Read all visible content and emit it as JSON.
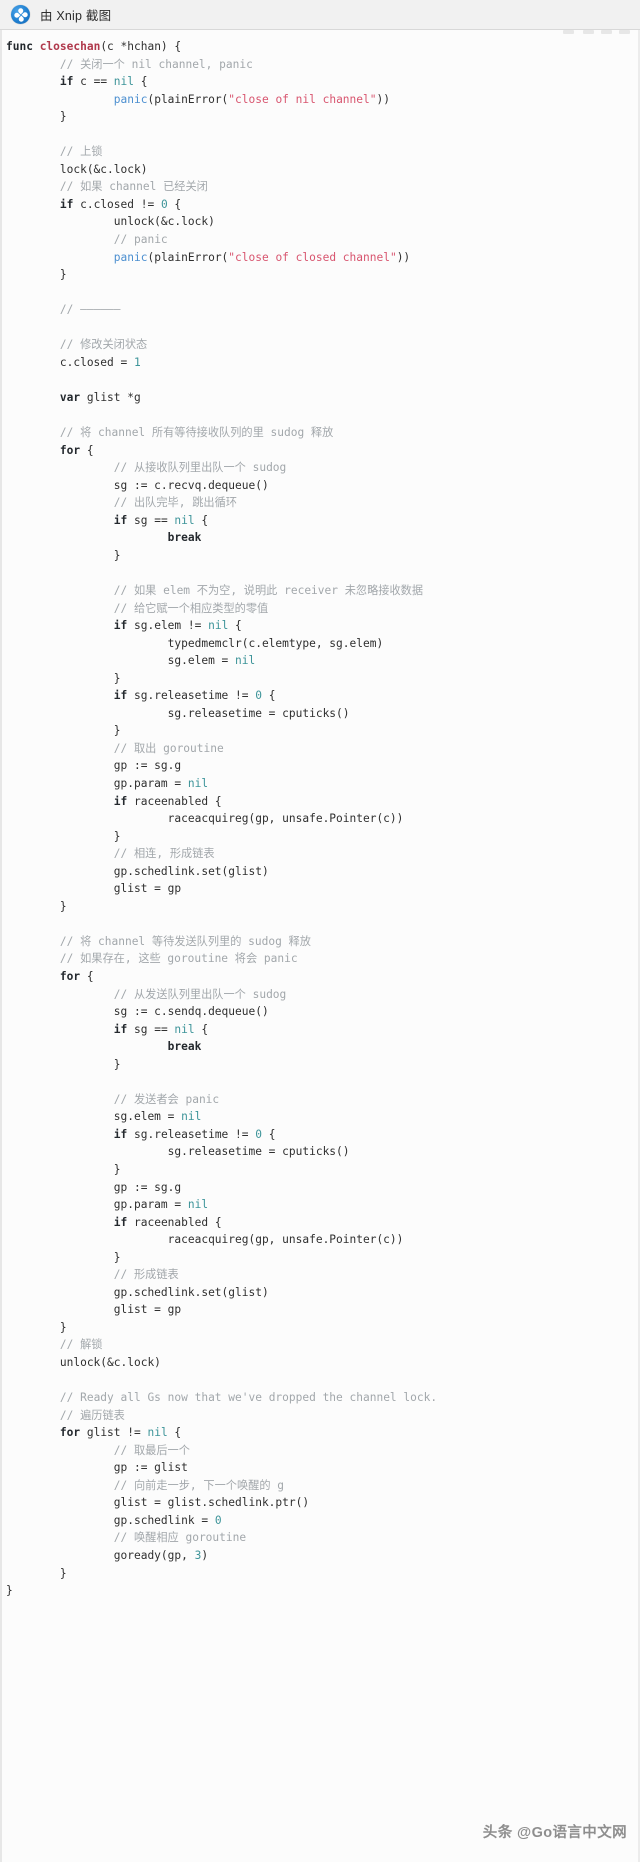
{
  "titlebar": {
    "logo_icon": "xnip-logo-icon",
    "label": "由 Xnip 截图"
  },
  "watermark": {
    "text": "头条 @Go语言中文网"
  },
  "colors": {
    "titlebar_bg": "#f1f1f1",
    "code_bg": "#fcfcfc",
    "keyword": "#24292e",
    "function_name": "#b0394c",
    "literal": "#3d9499",
    "number": "#3d9499",
    "panic": "#4c8fd0",
    "string": "#d8556f",
    "comment": "#a2a7ab",
    "plain": "#2f2f2f",
    "watermark": "#8e8e8e"
  },
  "code": {
    "language": "go",
    "function": "closechan",
    "lines": [
      [
        {
          "t": "func ",
          "c": "kw"
        },
        {
          "t": "closechan",
          "c": "fn"
        },
        {
          "t": "(c *hchan) {",
          "c": "pl"
        }
      ],
      [
        {
          "t": "        ",
          "c": "pl"
        },
        {
          "t": "// 关闭一个 nil channel, panic",
          "c": "cm"
        }
      ],
      [
        {
          "t": "        ",
          "c": "pl"
        },
        {
          "t": "if",
          "c": "kw"
        },
        {
          "t": " c == ",
          "c": "pl"
        },
        {
          "t": "nil",
          "c": "lit"
        },
        {
          "t": " {",
          "c": "pl"
        }
      ],
      [
        {
          "t": "                ",
          "c": "pl"
        },
        {
          "t": "panic",
          "c": "pan"
        },
        {
          "t": "(plainError(",
          "c": "pl"
        },
        {
          "t": "\"close of nil channel\"",
          "c": "str"
        },
        {
          "t": "))",
          "c": "pl"
        }
      ],
      [
        {
          "t": "        }",
          "c": "pl"
        }
      ],
      [
        {
          "t": "",
          "c": "pl"
        }
      ],
      [
        {
          "t": "        ",
          "c": "pl"
        },
        {
          "t": "// 上锁",
          "c": "cm"
        }
      ],
      [
        {
          "t": "        lock(&c.lock)",
          "c": "pl"
        }
      ],
      [
        {
          "t": "        ",
          "c": "pl"
        },
        {
          "t": "// 如果 channel 已经关闭",
          "c": "cm"
        }
      ],
      [
        {
          "t": "        ",
          "c": "pl"
        },
        {
          "t": "if",
          "c": "kw"
        },
        {
          "t": " c.closed != ",
          "c": "pl"
        },
        {
          "t": "0",
          "c": "num"
        },
        {
          "t": " {",
          "c": "pl"
        }
      ],
      [
        {
          "t": "                unlock(&c.lock)",
          "c": "pl"
        }
      ],
      [
        {
          "t": "                ",
          "c": "pl"
        },
        {
          "t": "// panic",
          "c": "cm"
        }
      ],
      [
        {
          "t": "                ",
          "c": "pl"
        },
        {
          "t": "panic",
          "c": "pan"
        },
        {
          "t": "(plainError(",
          "c": "pl"
        },
        {
          "t": "\"close of closed channel\"",
          "c": "str"
        },
        {
          "t": "))",
          "c": "pl"
        }
      ],
      [
        {
          "t": "        }",
          "c": "pl"
        }
      ],
      [
        {
          "t": "",
          "c": "pl"
        }
      ],
      [
        {
          "t": "        ",
          "c": "pl"
        },
        {
          "t": "// ——————",
          "c": "cm"
        }
      ],
      [
        {
          "t": "",
          "c": "pl"
        }
      ],
      [
        {
          "t": "        ",
          "c": "pl"
        },
        {
          "t": "// 修改关闭状态",
          "c": "cm"
        }
      ],
      [
        {
          "t": "        c.closed = ",
          "c": "pl"
        },
        {
          "t": "1",
          "c": "num"
        }
      ],
      [
        {
          "t": "",
          "c": "pl"
        }
      ],
      [
        {
          "t": "        ",
          "c": "pl"
        },
        {
          "t": "var",
          "c": "kw"
        },
        {
          "t": " glist *g",
          "c": "pl"
        }
      ],
      [
        {
          "t": "",
          "c": "pl"
        }
      ],
      [
        {
          "t": "        ",
          "c": "pl"
        },
        {
          "t": "// 将 channel 所有等待接收队列的里 sudog 释放",
          "c": "cm"
        }
      ],
      [
        {
          "t": "        ",
          "c": "pl"
        },
        {
          "t": "for",
          "c": "kw"
        },
        {
          "t": " {",
          "c": "pl"
        }
      ],
      [
        {
          "t": "                ",
          "c": "pl"
        },
        {
          "t": "// 从接收队列里出队一个 sudog",
          "c": "cm"
        }
      ],
      [
        {
          "t": "                sg := c.recvq.dequeue()",
          "c": "pl"
        }
      ],
      [
        {
          "t": "                ",
          "c": "pl"
        },
        {
          "t": "// 出队完毕, 跳出循环",
          "c": "cm"
        }
      ],
      [
        {
          "t": "                ",
          "c": "pl"
        },
        {
          "t": "if",
          "c": "kw"
        },
        {
          "t": " sg == ",
          "c": "pl"
        },
        {
          "t": "nil",
          "c": "lit"
        },
        {
          "t": " {",
          "c": "pl"
        }
      ],
      [
        {
          "t": "                        ",
          "c": "pl"
        },
        {
          "t": "break",
          "c": "kw"
        }
      ],
      [
        {
          "t": "                }",
          "c": "pl"
        }
      ],
      [
        {
          "t": "",
          "c": "pl"
        }
      ],
      [
        {
          "t": "                ",
          "c": "pl"
        },
        {
          "t": "// 如果 elem 不为空, 说明此 receiver 未忽略接收数据",
          "c": "cm"
        }
      ],
      [
        {
          "t": "                ",
          "c": "pl"
        },
        {
          "t": "// 给它赋一个相应类型的零值",
          "c": "cm"
        }
      ],
      [
        {
          "t": "                ",
          "c": "pl"
        },
        {
          "t": "if",
          "c": "kw"
        },
        {
          "t": " sg.elem != ",
          "c": "pl"
        },
        {
          "t": "nil",
          "c": "lit"
        },
        {
          "t": " {",
          "c": "pl"
        }
      ],
      [
        {
          "t": "                        typedmemclr(c.elemtype, sg.elem)",
          "c": "pl"
        }
      ],
      [
        {
          "t": "                        sg.elem = ",
          "c": "pl"
        },
        {
          "t": "nil",
          "c": "lit"
        }
      ],
      [
        {
          "t": "                }",
          "c": "pl"
        }
      ],
      [
        {
          "t": "                ",
          "c": "pl"
        },
        {
          "t": "if",
          "c": "kw"
        },
        {
          "t": " sg.releasetime != ",
          "c": "pl"
        },
        {
          "t": "0",
          "c": "num"
        },
        {
          "t": " {",
          "c": "pl"
        }
      ],
      [
        {
          "t": "                        sg.releasetime = cputicks()",
          "c": "pl"
        }
      ],
      [
        {
          "t": "                }",
          "c": "pl"
        }
      ],
      [
        {
          "t": "                ",
          "c": "pl"
        },
        {
          "t": "// 取出 goroutine",
          "c": "cm"
        }
      ],
      [
        {
          "t": "                gp := sg.g",
          "c": "pl"
        }
      ],
      [
        {
          "t": "                gp.param = ",
          "c": "pl"
        },
        {
          "t": "nil",
          "c": "lit"
        }
      ],
      [
        {
          "t": "                ",
          "c": "pl"
        },
        {
          "t": "if",
          "c": "kw"
        },
        {
          "t": " raceenabled {",
          "c": "pl"
        }
      ],
      [
        {
          "t": "                        raceacquireg(gp, unsafe.Pointer(c))",
          "c": "pl"
        }
      ],
      [
        {
          "t": "                }",
          "c": "pl"
        }
      ],
      [
        {
          "t": "                ",
          "c": "pl"
        },
        {
          "t": "// 相连, 形成链表",
          "c": "cm"
        }
      ],
      [
        {
          "t": "                gp.schedlink.set(glist)",
          "c": "pl"
        }
      ],
      [
        {
          "t": "                glist = gp",
          "c": "pl"
        }
      ],
      [
        {
          "t": "        }",
          "c": "pl"
        }
      ],
      [
        {
          "t": "",
          "c": "pl"
        }
      ],
      [
        {
          "t": "        ",
          "c": "pl"
        },
        {
          "t": "// 将 channel 等待发送队列里的 sudog 释放",
          "c": "cm"
        }
      ],
      [
        {
          "t": "        ",
          "c": "pl"
        },
        {
          "t": "// 如果存在, 这些 goroutine 将会 panic",
          "c": "cm"
        }
      ],
      [
        {
          "t": "        ",
          "c": "pl"
        },
        {
          "t": "for",
          "c": "kw"
        },
        {
          "t": " {",
          "c": "pl"
        }
      ],
      [
        {
          "t": "                ",
          "c": "pl"
        },
        {
          "t": "// 从发送队列里出队一个 sudog",
          "c": "cm"
        }
      ],
      [
        {
          "t": "                sg := c.sendq.dequeue()",
          "c": "pl"
        }
      ],
      [
        {
          "t": "                ",
          "c": "pl"
        },
        {
          "t": "if",
          "c": "kw"
        },
        {
          "t": " sg == ",
          "c": "pl"
        },
        {
          "t": "nil",
          "c": "lit"
        },
        {
          "t": " {",
          "c": "pl"
        }
      ],
      [
        {
          "t": "                        ",
          "c": "pl"
        },
        {
          "t": "break",
          "c": "kw"
        }
      ],
      [
        {
          "t": "                }",
          "c": "pl"
        }
      ],
      [
        {
          "t": "",
          "c": "pl"
        }
      ],
      [
        {
          "t": "                ",
          "c": "pl"
        },
        {
          "t": "// 发送者会 panic",
          "c": "cm"
        }
      ],
      [
        {
          "t": "                sg.elem = ",
          "c": "pl"
        },
        {
          "t": "nil",
          "c": "lit"
        }
      ],
      [
        {
          "t": "                ",
          "c": "pl"
        },
        {
          "t": "if",
          "c": "kw"
        },
        {
          "t": " sg.releasetime != ",
          "c": "pl"
        },
        {
          "t": "0",
          "c": "num"
        },
        {
          "t": " {",
          "c": "pl"
        }
      ],
      [
        {
          "t": "                        sg.releasetime = cputicks()",
          "c": "pl"
        }
      ],
      [
        {
          "t": "                }",
          "c": "pl"
        }
      ],
      [
        {
          "t": "                gp := sg.g",
          "c": "pl"
        }
      ],
      [
        {
          "t": "                gp.param = ",
          "c": "pl"
        },
        {
          "t": "nil",
          "c": "lit"
        }
      ],
      [
        {
          "t": "                ",
          "c": "pl"
        },
        {
          "t": "if",
          "c": "kw"
        },
        {
          "t": " raceenabled {",
          "c": "pl"
        }
      ],
      [
        {
          "t": "                        raceacquireg(gp, unsafe.Pointer(c))",
          "c": "pl"
        }
      ],
      [
        {
          "t": "                }",
          "c": "pl"
        }
      ],
      [
        {
          "t": "                ",
          "c": "pl"
        },
        {
          "t": "// 形成链表",
          "c": "cm"
        }
      ],
      [
        {
          "t": "                gp.schedlink.set(glist)",
          "c": "pl"
        }
      ],
      [
        {
          "t": "                glist = gp",
          "c": "pl"
        }
      ],
      [
        {
          "t": "        }",
          "c": "pl"
        }
      ],
      [
        {
          "t": "        ",
          "c": "pl"
        },
        {
          "t": "// 解锁",
          "c": "cm"
        }
      ],
      [
        {
          "t": "        unlock(&c.lock)",
          "c": "pl"
        }
      ],
      [
        {
          "t": "",
          "c": "pl"
        }
      ],
      [
        {
          "t": "        ",
          "c": "pl"
        },
        {
          "t": "// Ready all Gs now that we've dropped the channel lock.",
          "c": "cm"
        }
      ],
      [
        {
          "t": "        ",
          "c": "pl"
        },
        {
          "t": "// 遍历链表",
          "c": "cm"
        }
      ],
      [
        {
          "t": "        ",
          "c": "pl"
        },
        {
          "t": "for",
          "c": "kw"
        },
        {
          "t": " glist != ",
          "c": "pl"
        },
        {
          "t": "nil",
          "c": "lit"
        },
        {
          "t": " {",
          "c": "pl"
        }
      ],
      [
        {
          "t": "                ",
          "c": "pl"
        },
        {
          "t": "// 取最后一个",
          "c": "cm"
        }
      ],
      [
        {
          "t": "                gp := glist",
          "c": "pl"
        }
      ],
      [
        {
          "t": "                ",
          "c": "pl"
        },
        {
          "t": "// 向前走一步, 下一个唤醒的 g",
          "c": "cm"
        }
      ],
      [
        {
          "t": "                glist = glist.schedlink.ptr()",
          "c": "pl"
        }
      ],
      [
        {
          "t": "                gp.schedlink = ",
          "c": "pl"
        },
        {
          "t": "0",
          "c": "num"
        }
      ],
      [
        {
          "t": "                ",
          "c": "pl"
        },
        {
          "t": "// 唤醒相应 goroutine",
          "c": "cm"
        }
      ],
      [
        {
          "t": "                goready(gp, ",
          "c": "pl"
        },
        {
          "t": "3",
          "c": "num"
        },
        {
          "t": ")",
          "c": "pl"
        }
      ],
      [
        {
          "t": "        }",
          "c": "pl"
        }
      ],
      [
        {
          "t": "}",
          "c": "pl"
        }
      ]
    ]
  }
}
